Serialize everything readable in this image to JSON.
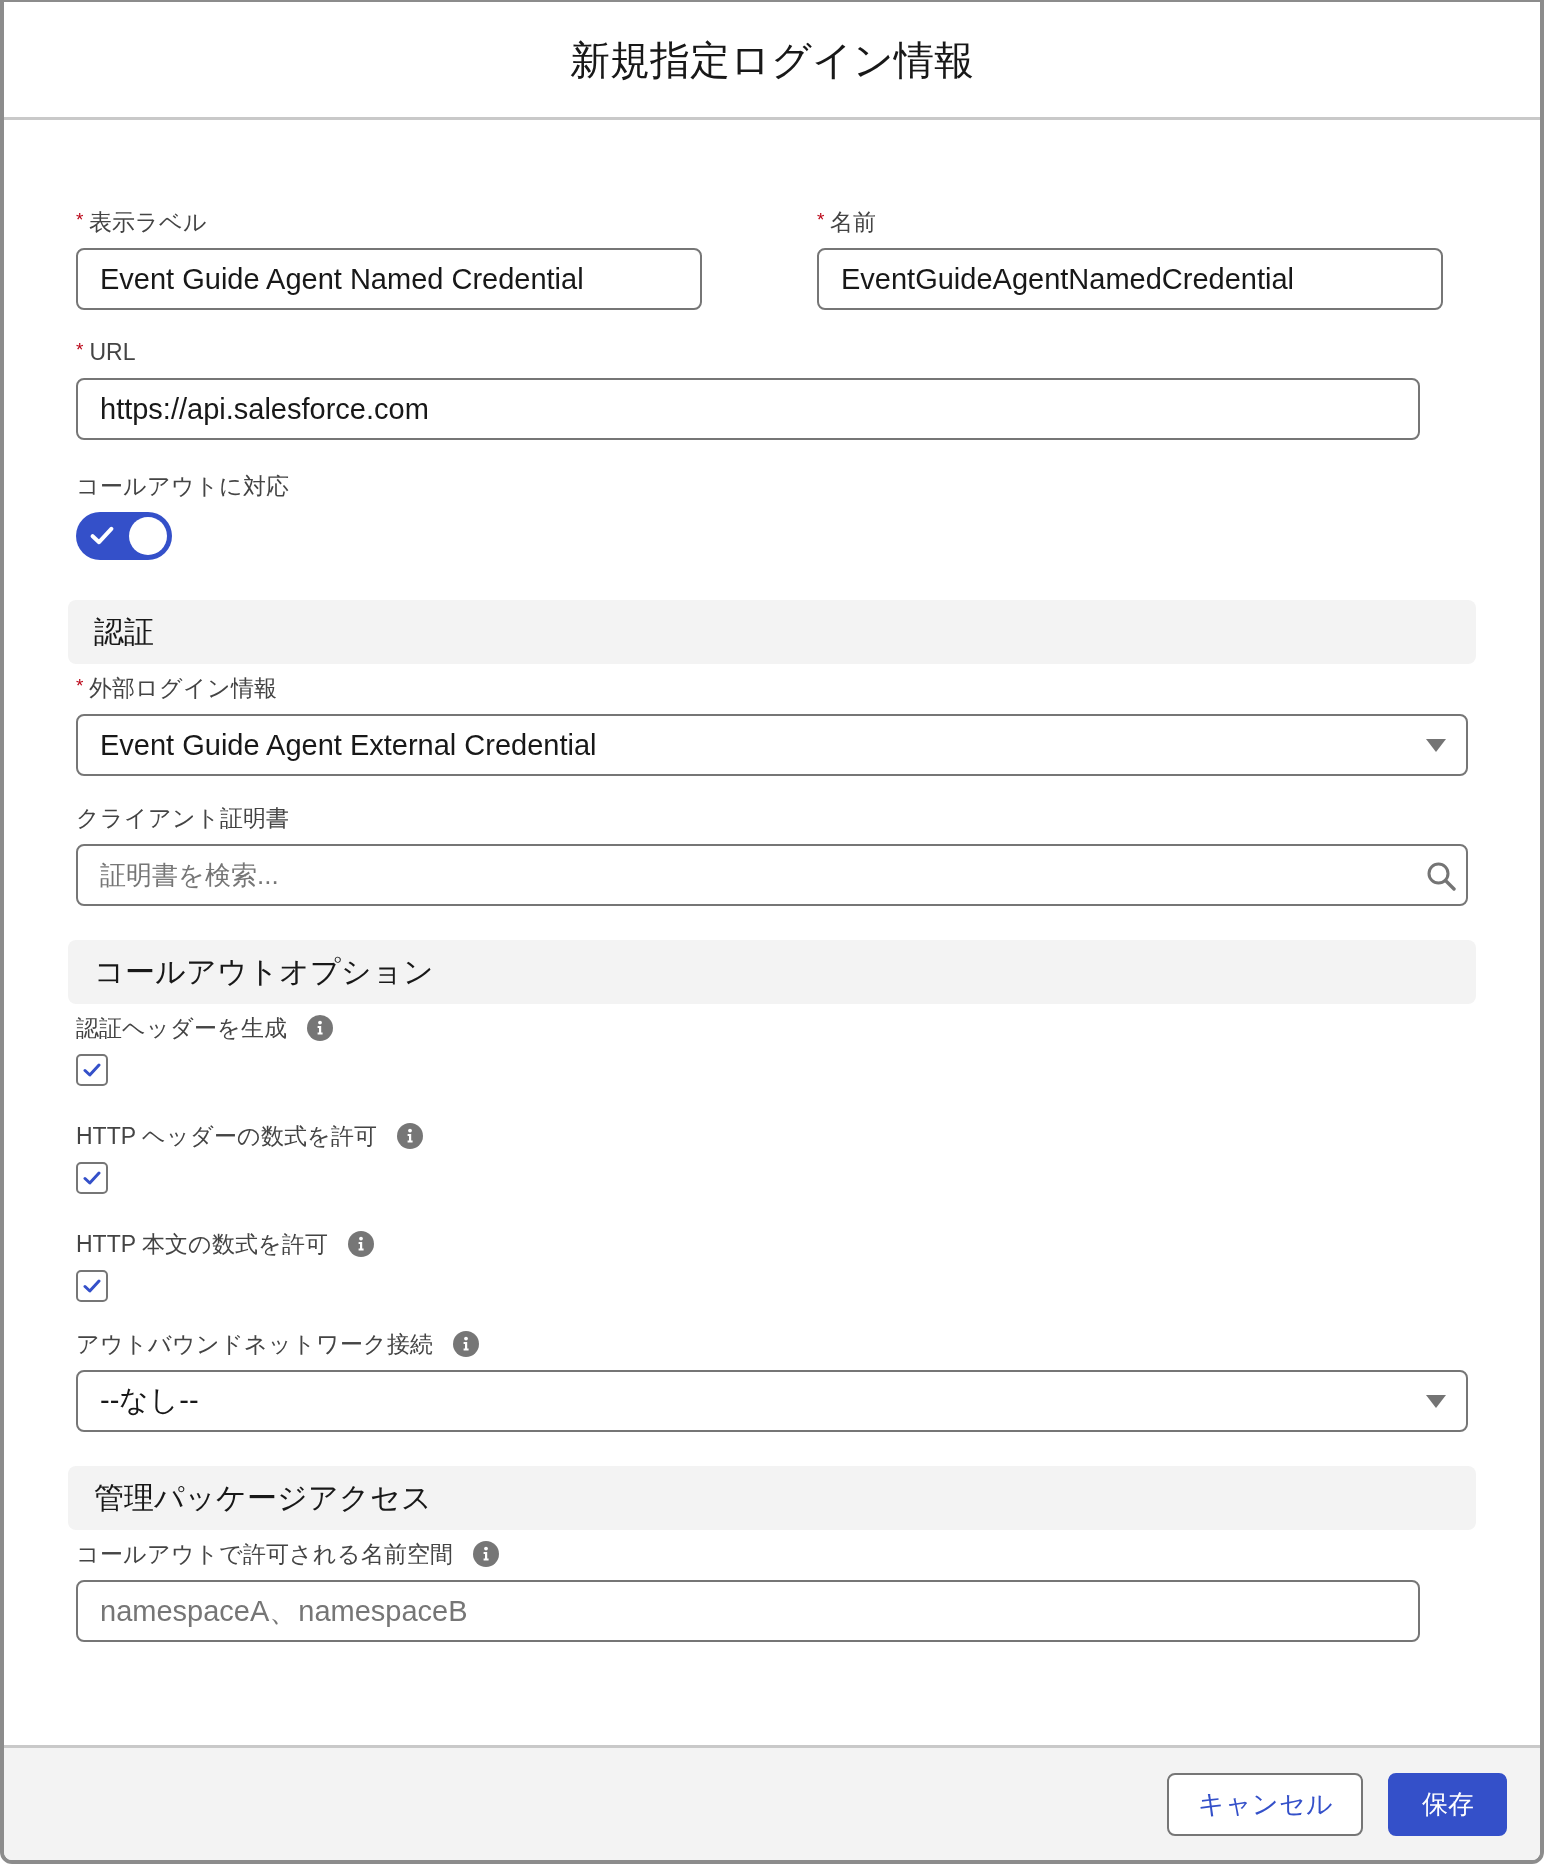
{
  "window": {
    "title": "新規指定ログイン情報"
  },
  "form": [
    {
      "kind": "row",
      "fields": [
        {
          "kind": "text",
          "label": "表示ラベル",
          "required_marker": "*",
          "info": false,
          "value": "Event Guide Agent Named Credential"
        },
        {
          "kind": "text",
          "label": "名前",
          "required_marker": "*",
          "info": false,
          "value": "EventGuideAgentNamedCredential"
        }
      ]
    },
    {
      "kind": "text",
      "label": "URL",
      "required_marker": "*",
      "info": false,
      "value": "https://api.salesforce.com"
    },
    {
      "kind": "toggle",
      "label": "コールアウトに対応",
      "info": false,
      "on": true
    },
    {
      "kind": "section",
      "title": "認証"
    },
    {
      "kind": "select",
      "label": "外部ログイン情報",
      "required_marker": "*",
      "info": false,
      "value": "Event Guide Agent External Credential"
    },
    {
      "kind": "search",
      "label": "クライアント証明書",
      "info": false,
      "placeholder": "証明書を検索..."
    },
    {
      "kind": "section",
      "title": "コールアウトオプション"
    },
    {
      "kind": "checkbox",
      "label": "認証ヘッダーを生成",
      "info": true,
      "checked": true
    },
    {
      "kind": "checkbox",
      "label": "HTTP ヘッダーの数式を許可",
      "info": true,
      "checked": true
    },
    {
      "kind": "checkbox",
      "label": "HTTP 本文の数式を許可",
      "info": true,
      "checked": true
    },
    {
      "kind": "select",
      "label": "アウトバウンドネットワーク接続",
      "info": true,
      "value": "--なし--"
    },
    {
      "kind": "section",
      "title": "管理パッケージアクセス"
    },
    {
      "kind": "text",
      "label": "コールアウトで許可される名前空間",
      "info": true,
      "placeholder": "namespaceA、namespaceB"
    }
  ],
  "footer": {
    "buttons": [
      {
        "kind": "neutral",
        "label": "キャンセル"
      },
      {
        "kind": "brand",
        "label": "保存"
      }
    ]
  }
}
